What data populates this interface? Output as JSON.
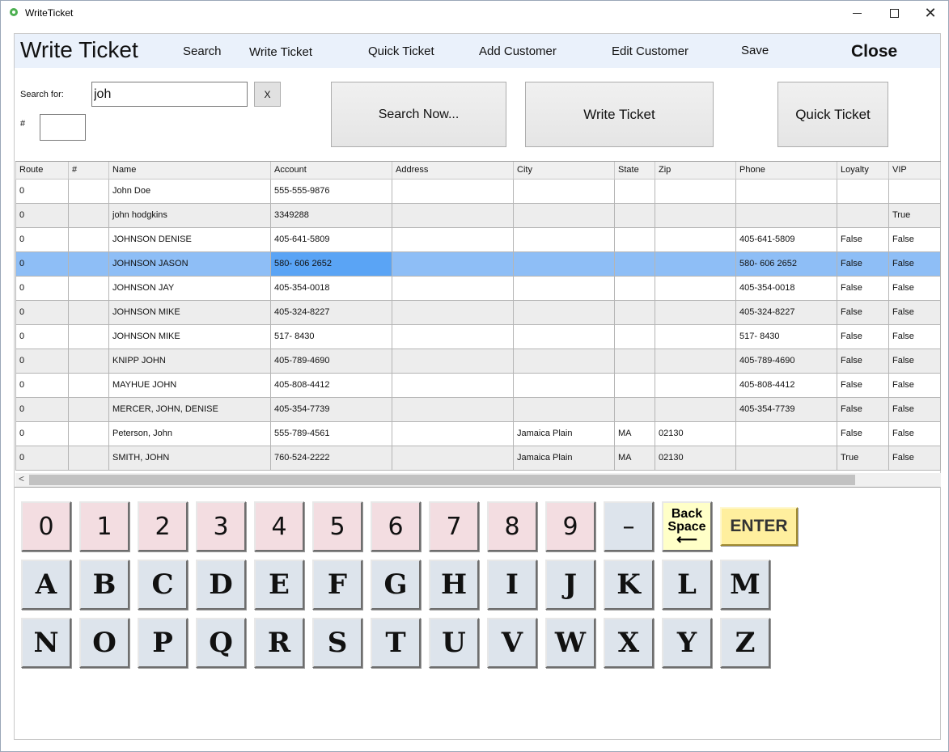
{
  "window": {
    "title": "WriteTicket"
  },
  "menu": {
    "page_title": "Write Ticket",
    "items": [
      "Search",
      "Write Ticket",
      "Quick Ticket",
      "Add Customer",
      "Edit Customer",
      "Save"
    ],
    "close": "Close"
  },
  "search": {
    "label": "Search for:",
    "value": "joh",
    "clear": "X",
    "num_label": "#",
    "num_value": ""
  },
  "buttons": {
    "search_now": "Search Now...",
    "write_ticket": "Write Ticket",
    "quick_ticket": "Quick Ticket"
  },
  "table": {
    "columns": [
      "Route",
      "#",
      "Name",
      "Account",
      "Address",
      "City",
      "State",
      "Zip",
      "Phone",
      "Loyalty",
      "VIP"
    ],
    "selected_row": 3,
    "rows": [
      [
        "0",
        "",
        "John Doe",
        "555-555-9876",
        "",
        "",
        "",
        "",
        "",
        "",
        ""
      ],
      [
        "0",
        "",
        "john hodgkins",
        "3349288",
        "",
        "",
        "",
        "",
        "",
        "",
        "True"
      ],
      [
        "0",
        "",
        "JOHNSON DENISE",
        "405-641-5809",
        "",
        "",
        "",
        "",
        "405-641-5809",
        "False",
        "False"
      ],
      [
        "0",
        "",
        "JOHNSON JASON",
        "580- 606 2652",
        "",
        "",
        "",
        "",
        "580- 606 2652",
        "False",
        "False"
      ],
      [
        "0",
        "",
        "JOHNSON JAY",
        "405-354-0018",
        "",
        "",
        "",
        "",
        "405-354-0018",
        "False",
        "False"
      ],
      [
        "0",
        "",
        "JOHNSON MIKE",
        "405-324-8227",
        "",
        "",
        "",
        "",
        "405-324-8227",
        "False",
        "False"
      ],
      [
        "0",
        "",
        "JOHNSON MIKE",
        "517- 8430",
        "",
        "",
        "",
        "",
        "517- 8430",
        "False",
        "False"
      ],
      [
        "0",
        "",
        "KNIPP JOHN",
        "405-789-4690",
        "",
        "",
        "",
        "",
        "405-789-4690",
        "False",
        "False"
      ],
      [
        "0",
        "",
        "MAYHUE JOHN",
        "405-808-4412",
        "",
        "",
        "",
        "",
        "405-808-4412",
        "False",
        "False"
      ],
      [
        "0",
        "",
        "MERCER, JOHN, DENISE",
        "405-354-7739",
        "",
        "",
        "",
        "",
        "405-354-7739",
        "False",
        "False"
      ],
      [
        "0",
        "",
        "Peterson, John",
        "555-789-4561",
        "",
        "Jamaica Plain",
        "MA",
        "02130",
        "",
        "False",
        "False"
      ],
      [
        "0",
        "",
        "SMITH, JOHN",
        "760-524-2222",
        "",
        "Jamaica Plain",
        "MA",
        "02130",
        "",
        "True",
        "False"
      ]
    ]
  },
  "keyboard": {
    "numbers": [
      "0",
      "1",
      "2",
      "3",
      "4",
      "5",
      "6",
      "7",
      "8",
      "9"
    ],
    "dash": "–",
    "backspace_line1": "Back",
    "backspace_line2": "Space",
    "backspace_arrow": "⟵",
    "enter": "ENTER",
    "row1": [
      "A",
      "B",
      "C",
      "D",
      "E",
      "F",
      "G",
      "H",
      "I",
      "J",
      "K",
      "L",
      "M"
    ],
    "row2": [
      "N",
      "O",
      "P",
      "Q",
      "R",
      "S",
      "T",
      "U",
      "V",
      "W",
      "X",
      "Y",
      "Z"
    ]
  },
  "colors": {
    "menubar": "#eaf1fb",
    "selected_row": "#8ebef6",
    "selected_cell": "#5aa4f5",
    "number_key": "#f3dde1",
    "letter_key": "#dde4ec",
    "enter_key": "#ffef9e",
    "backspace_key": "#ffffc8"
  },
  "icons": {
    "app": "app-icon",
    "minimize": "minimize-icon",
    "maximize": "maximize-icon",
    "close": "close-icon",
    "scroll_left": "chevron-left-icon"
  }
}
